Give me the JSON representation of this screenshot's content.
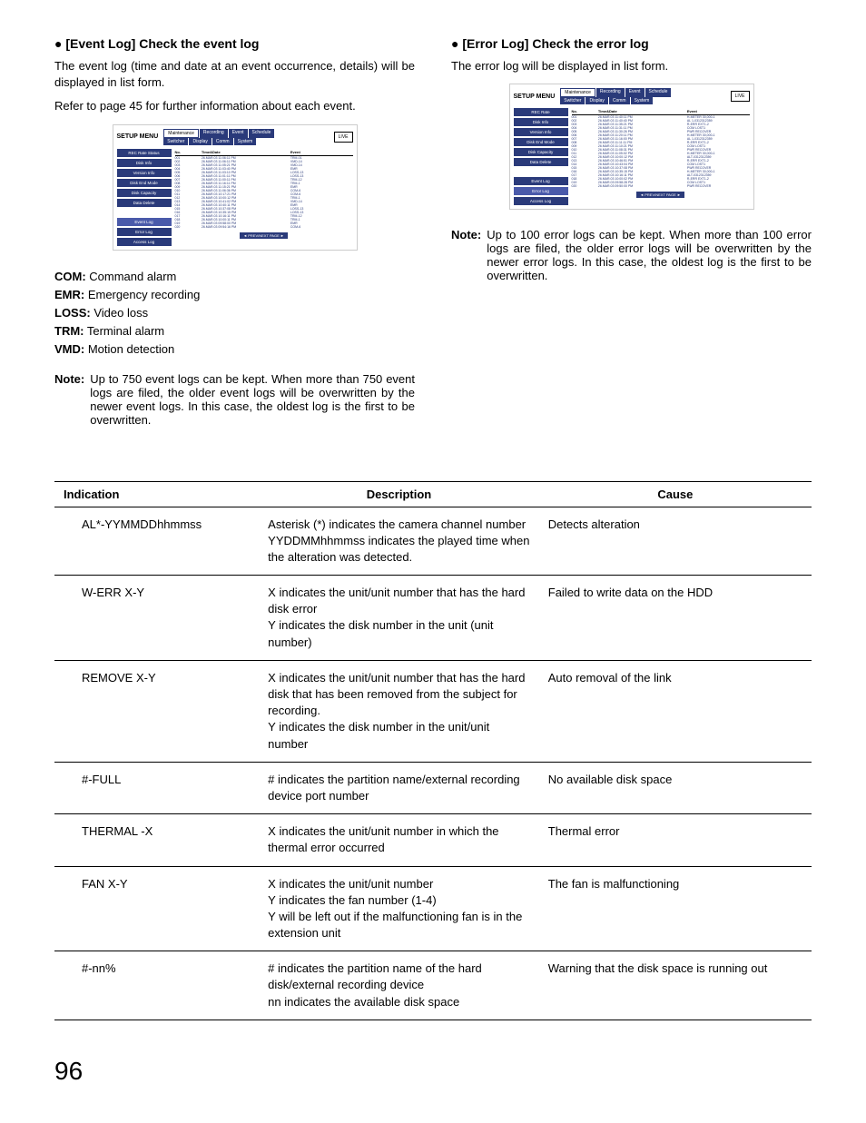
{
  "left": {
    "heading": "● [Event Log] Check the event log",
    "p1": "The event log (time and date at an event occurrence, details) will be displayed in list form.",
    "p2": "Refer to page 45 for further information about each event.",
    "legend": {
      "com": {
        "k": "COM:",
        "v": " Command alarm"
      },
      "emr": {
        "k": "EMR:",
        "v": " Emergency recording"
      },
      "loss": {
        "k": "LOSS:",
        "v": " Video loss"
      },
      "trm": {
        "k": "TRM:",
        "v": " Terminal alarm"
      },
      "vmd": {
        "k": "VMD:",
        "v": " Motion detection"
      }
    },
    "note_label": "Note:",
    "note_text": "Up to 750 event logs can be kept. When more than 750 event logs are filed, the older event logs will be overwritten by the newer event logs. In this case, the oldest log is the first to be overwritten."
  },
  "right": {
    "heading": "● [Error Log] Check the error log",
    "p1": "The error log will be displayed in list form.",
    "note_label": "Note:",
    "note_text": "Up to 100 error logs can be kept. When more than 100 error logs are filed, the older error logs will be overwritten by the newer error logs. In this case, the oldest log is the first to be overwritten."
  },
  "setup": {
    "title": "SETUP MENU",
    "tabs_top": [
      "Maintenance",
      "Recording",
      "Event",
      "Schedule"
    ],
    "tabs_bottom": [
      "Switcher",
      "Display",
      "Comm",
      "System"
    ],
    "live": "LIVE",
    "sidebar1": [
      "REC Rate Status",
      "Disk Info",
      "Version Info",
      "Disk End Mode",
      "Disk Capacity",
      "Data Delete",
      "",
      "Event Log",
      "Error Log",
      "Access Log"
    ],
    "sidebar2": [
      "REC Rate",
      "Disk Info",
      "Version Info",
      "Disk End Mode",
      "Disk Capacity",
      "Data Delete",
      "",
      "Event Log",
      "Error Log",
      "Access Log"
    ],
    "log_header": {
      "no": "No.",
      "date": "Time&Date",
      "event": "Event"
    },
    "pager": "◄ PREV/NEXT PAGE ►",
    "event_rows": [
      {
        "no": "001",
        "date": "26.MAR.03 11:06:11 PM",
        "ev": "TRM-01"
      },
      {
        "no": "002",
        "date": "26.MAR.03 11:06:11 PM",
        "ev": "VMD-14"
      },
      {
        "no": "003",
        "date": "26.MAR.03 11:05:21 PM",
        "ev": "VMD-14"
      },
      {
        "no": "004",
        "date": "26.MAR.03 11:03:40 PM",
        "ev": "EMR"
      },
      {
        "no": "005",
        "date": "26.MAR.03 11:03:10 PM",
        "ev": "LOSS-13"
      },
      {
        "no": "006",
        "date": "26.MAR.03 11:01:11 PM",
        "ev": "LOSS-13"
      },
      {
        "no": "007",
        "date": "26.MAR.03 11:00:11 PM",
        "ev": "TRM-12"
      },
      {
        "no": "008",
        "date": "26.MAR.03 11:16:11 PM",
        "ev": "TRM-1"
      },
      {
        "no": "009",
        "date": "26.MAR.03 11:15:21 PM",
        "ev": "EMR"
      },
      {
        "no": "010",
        "date": "26.MAR.03 11:06:36 PM",
        "ev": "COM-6"
      },
      {
        "no": "011",
        "date": "26.MAR.03 10:17:21 PM",
        "ev": "COM-6"
      },
      {
        "no": "012",
        "date": "26.MAR.03 10:00:12 PM",
        "ev": "TRM-1"
      },
      {
        "no": "013",
        "date": "26.MAR.03 10:41:02 PM",
        "ev": "VMD-14"
      },
      {
        "no": "014",
        "date": "26.MAR.03 10:40:11 PM",
        "ev": "EMR"
      },
      {
        "no": "015",
        "date": "26.MAR.03 10:37:08 PM",
        "ev": "LOSS-13"
      },
      {
        "no": "016",
        "date": "26.MAR.03 10:35:15 PM",
        "ev": "LOSS-13"
      },
      {
        "no": "017",
        "date": "26.MAR.03 10:16:11 PM",
        "ev": "TRM-12"
      },
      {
        "no": "018",
        "date": "26.MAR.03 10:00:11 PM",
        "ev": "TRM-1"
      },
      {
        "no": "019",
        "date": "26.MAR.03 09:58:00 PM",
        "ev": "EMR"
      },
      {
        "no": "020",
        "date": "26.MAR.03 09:54:16 PM",
        "ev": "COM-6"
      }
    ],
    "error_rows": [
      {
        "no": "001",
        "date": "26.MAR.03 11:40:11 PM",
        "ev": "H-METER 30,000-1"
      },
      {
        "no": "002",
        "date": "26.MAR.03 11:40:40 PM",
        "ev": "AL 1-0312312359"
      },
      {
        "no": "003",
        "date": "26.MAR.03 11:35:21 PM",
        "ev": "R-ERR EXT1-2"
      },
      {
        "no": "004",
        "date": "26.MAR.03 11:31:11 PM",
        "ev": "COM LOST1"
      },
      {
        "no": "005",
        "date": "26.MAR.03 11:30:26 PM",
        "ev": "PWR RECOVER"
      },
      {
        "no": "006",
        "date": "26.MAR.03 11:20:11 PM",
        "ev": "H-METER 30,000-1"
      },
      {
        "no": "007",
        "date": "26.MAR.03 11:16:00 PM",
        "ev": "AL 1-0312312359"
      },
      {
        "no": "008",
        "date": "26.MAR.03 11:11:11 PM",
        "ev": "R-ERR EXT1-2"
      },
      {
        "no": "009",
        "date": "26.MAR.03 11:10:21 PM",
        "ev": "COM LOST1"
      },
      {
        "no": "010",
        "date": "26.MAR.03 11:08:31 PM",
        "ev": "PWR RECOVER"
      },
      {
        "no": "011",
        "date": "26.MAR.03 11:05:02 PM",
        "ev": "H-METER 30,000-1"
      },
      {
        "no": "012",
        "date": "26.MAR.03 10:00:12 PM",
        "ev": "ALT-0312312359"
      },
      {
        "no": "013",
        "date": "26.MAR.03 10:46:51 PM",
        "ev": "R-ERR EXT1-2"
      },
      {
        "no": "014",
        "date": "26.MAR.03 10:43:04 PM",
        "ev": "COM LOST1"
      },
      {
        "no": "015",
        "date": "26.MAR.03 10:37:08 PM",
        "ev": "PWR RECOVER"
      },
      {
        "no": "016",
        "date": "26.MAR.03 10:35:15 PM",
        "ev": "H-METER 30,000-1"
      },
      {
        "no": "017",
        "date": "26.MAR.03 10:16:11 PM",
        "ev": "ALT-0312312359"
      },
      {
        "no": "018",
        "date": "26.MAR.03 10:00:02 PM",
        "ev": "R-ERR EXT1-2"
      },
      {
        "no": "019",
        "date": "26.MAR.03 09:58:28 PM",
        "ev": "COM LOST1"
      },
      {
        "no": "020",
        "date": "26.MAR.03 09:50:00 PM",
        "ev": "PWR RECOVER"
      }
    ]
  },
  "table": {
    "headers": {
      "ind": "Indication",
      "desc": "Description",
      "cause": "Cause"
    },
    "rows": [
      {
        "ind": "AL*-YYMMDDhhmmss",
        "desc": "Asterisk (*) indicates the camera channel number\nYYDDMMhhmmss indicates the played time when the alteration was detected.",
        "cause": "Detects alteration"
      },
      {
        "ind": "W-ERR X-Y",
        "desc": "X indicates the unit/unit number that has the hard disk error\nY indicates the disk number in the unit (unit number)",
        "cause": "Failed to write data on the HDD"
      },
      {
        "ind": "REMOVE X-Y",
        "desc": "X indicates the unit/unit number that has the hard disk that has been removed from the subject for recording.\nY indicates the disk number in the unit/unit number",
        "cause": "Auto removal of the link"
      },
      {
        "ind": "#-FULL",
        "desc": "# indicates the partition name/external recording device port number",
        "cause": "No available disk space"
      },
      {
        "ind": "THERMAL -X",
        "desc": "X indicates the unit/unit number in which the thermal error occurred",
        "cause": "Thermal error"
      },
      {
        "ind": "FAN X-Y",
        "desc": "X indicates the unit/unit number\nY indicates the fan number (1-4)\nY will be left out if the malfunctioning fan is in the extension unit",
        "cause": "The fan is malfunctioning"
      },
      {
        "ind": "#-nn%",
        "desc": "# indicates the partition name of the hard disk/external recording device\nnn indicates the available disk space",
        "cause": "Warning that the disk space is running out"
      }
    ]
  },
  "page_number": "96"
}
